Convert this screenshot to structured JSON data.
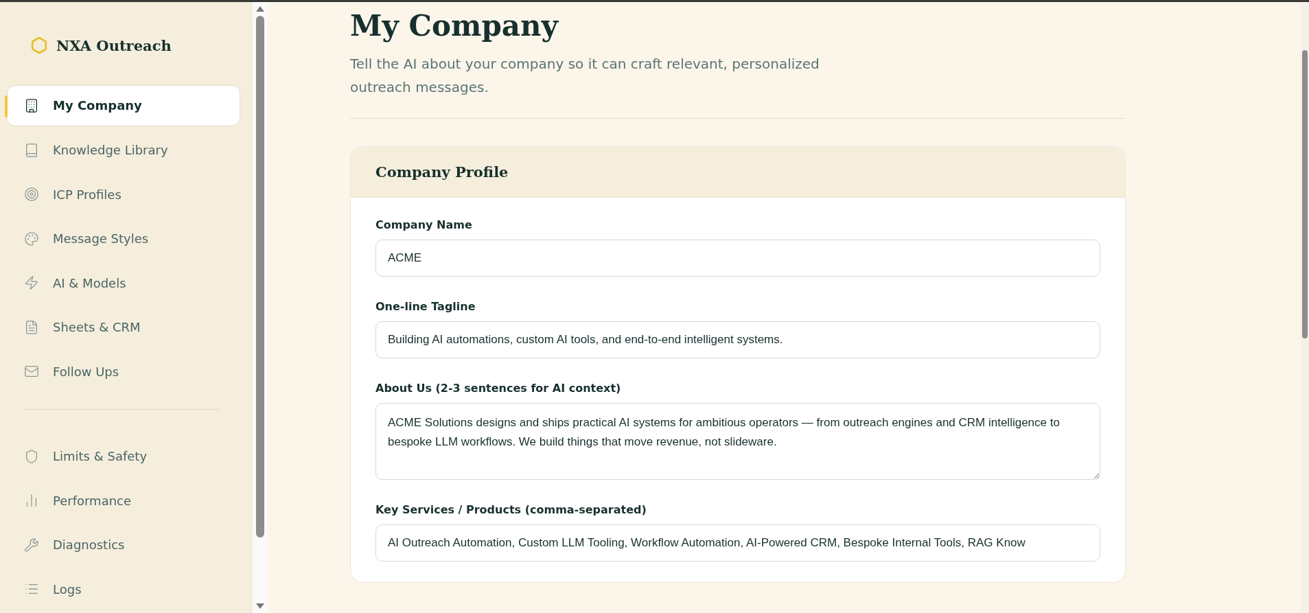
{
  "sidebar": {
    "brand": "NXA Outreach",
    "groups": [
      {
        "items": [
          {
            "label": "My Company",
            "selected": true
          },
          {
            "label": "Knowledge Library",
            "selected": false
          },
          {
            "label": "ICP Profiles",
            "selected": false
          },
          {
            "label": "Message Styles",
            "selected": false
          },
          {
            "label": "AI & Models",
            "selected": false
          },
          {
            "label": "Sheets & CRM",
            "selected": false
          },
          {
            "label": "Follow Ups",
            "selected": false
          }
        ]
      },
      {
        "items": [
          {
            "label": "Limits & Safety",
            "selected": false
          },
          {
            "label": "Performance",
            "selected": false
          },
          {
            "label": "Diagnostics",
            "selected": false
          },
          {
            "label": "Logs",
            "selected": false
          }
        ]
      }
    ]
  },
  "page": {
    "title": "My Company",
    "subtitle": "Tell the AI about your company so it can craft relevant, personalized outreach messages."
  },
  "card": {
    "title": "Company Profile",
    "fields": [
      {
        "kind": "input",
        "label": "Company Name",
        "value": "ACME"
      },
      {
        "kind": "input",
        "label": "One-line Tagline",
        "value": "Building AI automations, custom AI tools, and end-to-end intelligent systems."
      },
      {
        "kind": "textarea",
        "label": "About Us (2-3 sentences for AI context)",
        "value": "ACME Solutions designs and ships practical AI systems for ambitious operators — from outreach engines and CRM intelligence to bespoke LLM workflows. We build things that move revenue, not slideware."
      },
      {
        "kind": "input",
        "label": "Key Services / Products (comma-separated)",
        "value": "AI Outreach Automation, Custom LLM Tooling, Workflow Automation, AI-Powered CRM, Bespoke Internal Tools, RAG Know"
      }
    ]
  }
}
